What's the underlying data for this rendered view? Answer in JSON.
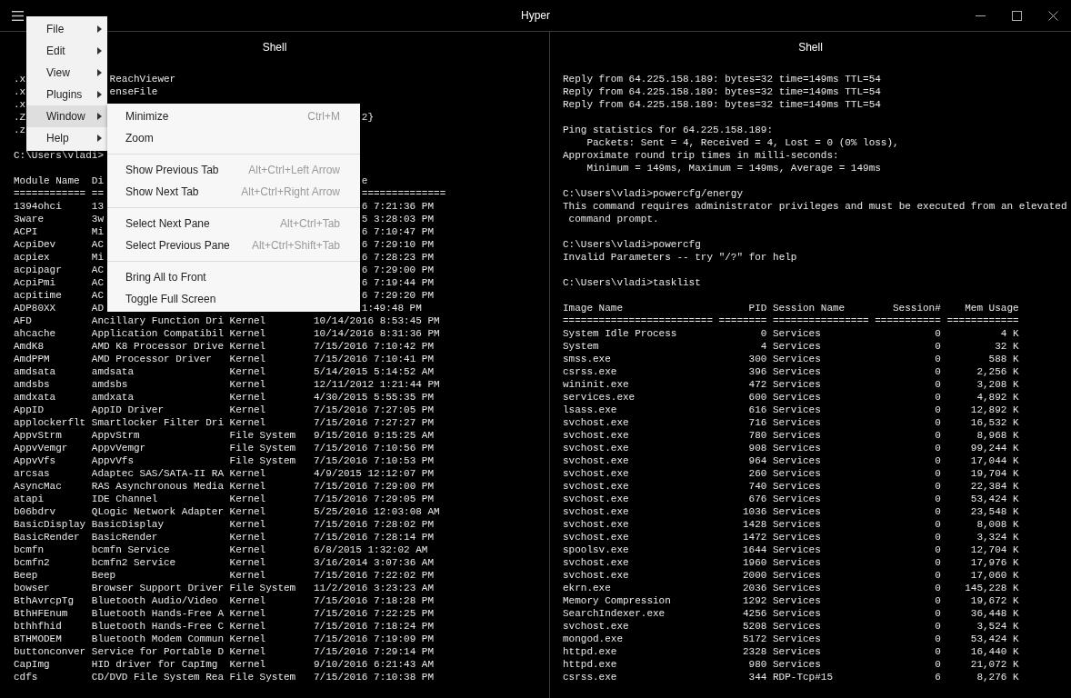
{
  "window": {
    "title": "Hyper"
  },
  "menu": {
    "items": [
      {
        "label": "File",
        "selected": false
      },
      {
        "label": "Edit",
        "selected": false
      },
      {
        "label": "View",
        "selected": false
      },
      {
        "label": "Plugins",
        "selected": false
      },
      {
        "label": "Window",
        "selected": true,
        "groups": [
          {
            "items": [
              {
                "label": "Minimize",
                "shortcut": "Ctrl+M"
              },
              {
                "label": "Zoom"
              }
            ]
          },
          {
            "items": [
              {
                "label": "Show Previous Tab",
                "shortcut": "Alt+Ctrl+Left Arrow"
              },
              {
                "label": "Show Next Tab",
                "shortcut": "Alt+Ctrl+Right Arrow"
              }
            ]
          },
          {
            "items": [
              {
                "label": "Select Next Pane",
                "shortcut": "Alt+Ctrl+Tab"
              },
              {
                "label": "Select Previous Pane",
                "shortcut": "Alt+Ctrl+Shift+Tab"
              }
            ]
          },
          {
            "items": [
              {
                "label": "Bring All to Front"
              },
              {
                "label": "Toggle Full Screen"
              }
            ]
          }
        ]
      },
      {
        "label": "Help",
        "selected": false
      }
    ]
  },
  "panes": [
    {
      "title": "Shell",
      "lines": [
        {
          "kind": "clipped",
          "head": ".x",
          "tail": "ReachViewer"
        },
        {
          "kind": "clipped",
          "head": ".x",
          "tail": "enseFile"
        },
        {
          "kind": "text",
          "text": ".x"
        },
        {
          "kind": "cut-row",
          "cells": [
            ".Z"
          ],
          "tail": "2}"
        },
        {
          "kind": "text",
          "text": ".z"
        },
        {
          "kind": "blank"
        },
        {
          "kind": "text",
          "text": "C:\\Users\\vladi>"
        },
        {
          "kind": "blank"
        },
        {
          "kind": "cut-row",
          "cells": [
            "Module Name",
            "Di"
          ],
          "tail": "e"
        },
        {
          "kind": "cut-row",
          "cells": [
            "============",
            "=="
          ],
          "tail": "=============="
        },
        {
          "kind": "cut-row",
          "cells": [
            "1394ohci",
            "13"
          ],
          "tail": "6 7:21:36 PM"
        },
        {
          "kind": "cut-row",
          "cells": [
            "3ware",
            "3w"
          ],
          "tail": "5 3:28:03 PM"
        },
        {
          "kind": "cut-row",
          "cells": [
            "ACPI",
            "Mi"
          ],
          "tail": "6 7:10:47 PM"
        },
        {
          "kind": "cut-row",
          "cells": [
            "AcpiDev",
            "AC"
          ],
          "tail": "6 7:29:10 PM"
        },
        {
          "kind": "cut-row",
          "cells": [
            "acpiex",
            "Mi"
          ],
          "tail": "6 7:28:23 PM"
        },
        {
          "kind": "cut-row",
          "cells": [
            "acpipagr",
            "AC"
          ],
          "tail": "6 7:29:00 PM"
        },
        {
          "kind": "cut-row",
          "cells": [
            "AcpiPmi",
            "AC"
          ],
          "tail": "6 7:19:44 PM"
        },
        {
          "kind": "cut-row",
          "cells": [
            "acpitime",
            "AC"
          ],
          "tail": "6 7:29:20 PM"
        },
        {
          "kind": "cut-row",
          "cells": [
            "ADP80XX",
            "AD"
          ],
          "tail": "1:49:48 PM"
        },
        {
          "kind": "module-row",
          "cells": [
            "AFD",
            "Ancillary Function Dri",
            "Kernel",
            "10/14/2016 8:53:45 PM"
          ]
        },
        {
          "kind": "module-row",
          "cells": [
            "ahcache",
            "Application Compatibil",
            "Kernel",
            "10/14/2016 8:31:36 PM"
          ]
        },
        {
          "kind": "module-row",
          "cells": [
            "AmdK8",
            "AMD K8 Processor Drive",
            "Kernel",
            "7/15/2016 7:10:42 PM"
          ]
        },
        {
          "kind": "module-row",
          "cells": [
            "AmdPPM",
            "AMD Processor Driver",
            "Kernel",
            "7/15/2016 7:10:41 PM"
          ]
        },
        {
          "kind": "module-row",
          "cells": [
            "amdsata",
            "amdsata",
            "Kernel",
            "5/14/2015 5:14:52 AM"
          ]
        },
        {
          "kind": "module-row",
          "cells": [
            "amdsbs",
            "amdsbs",
            "Kernel",
            "12/11/2012 1:21:44 PM"
          ]
        },
        {
          "kind": "module-row",
          "cells": [
            "amdxata",
            "amdxata",
            "Kernel",
            "4/30/2015 5:55:35 PM"
          ]
        },
        {
          "kind": "module-row",
          "cells": [
            "AppID",
            "AppID Driver",
            "Kernel",
            "7/15/2016 7:27:05 PM"
          ]
        },
        {
          "kind": "module-row",
          "cells": [
            "applockerflt",
            "Smartlocker Filter Dri",
            "Kernel",
            "7/15/2016 7:27:27 PM"
          ]
        },
        {
          "kind": "module-row",
          "cells": [
            "AppvStrm",
            "AppvStrm",
            "File System",
            "9/15/2016 9:15:25 AM"
          ]
        },
        {
          "kind": "module-row",
          "cells": [
            "AppvVemgr",
            "AppvVemgr",
            "File System",
            "7/15/2016 7:10:56 PM"
          ]
        },
        {
          "kind": "module-row",
          "cells": [
            "AppvVfs",
            "AppvVfs",
            "File System",
            "7/15/2016 7:10:53 PM"
          ]
        },
        {
          "kind": "module-row",
          "cells": [
            "arcsas",
            "Adaptec SAS/SATA-II RA",
            "Kernel",
            "4/9/2015 12:12:07 PM"
          ]
        },
        {
          "kind": "module-row",
          "cells": [
            "AsyncMac",
            "RAS Asynchronous Media",
            "Kernel",
            "7/15/2016 7:29:00 PM"
          ]
        },
        {
          "kind": "module-row",
          "cells": [
            "atapi",
            "IDE Channel",
            "Kernel",
            "7/15/2016 7:29:05 PM"
          ]
        },
        {
          "kind": "module-row",
          "cells": [
            "b06bdrv",
            "QLogic Network Adapter",
            "Kernel",
            "5/25/2016 12:03:08 AM"
          ]
        },
        {
          "kind": "module-row",
          "cells": [
            "BasicDisplay",
            "BasicDisplay",
            "Kernel",
            "7/15/2016 7:28:02 PM"
          ]
        },
        {
          "kind": "module-row",
          "cells": [
            "BasicRender",
            "BasicRender",
            "Kernel",
            "7/15/2016 7:28:14 PM"
          ]
        },
        {
          "kind": "module-row",
          "cells": [
            "bcmfn",
            "bcmfn Service",
            "Kernel",
            "6/8/2015 1:32:02 AM"
          ]
        },
        {
          "kind": "module-row",
          "cells": [
            "bcmfn2",
            "bcmfn2 Service",
            "Kernel",
            "3/16/2014 3:07:36 AM"
          ]
        },
        {
          "kind": "module-row",
          "cells": [
            "Beep",
            "Beep",
            "Kernel",
            "7/15/2016 7:22:02 PM"
          ]
        },
        {
          "kind": "module-row",
          "cells": [
            "bowser",
            "Browser Support Driver",
            "File System",
            "11/2/2016 3:23:23 AM"
          ]
        },
        {
          "kind": "module-row",
          "cells": [
            "BthAvrcpTg",
            "Bluetooth Audio/Video",
            "Kernel",
            "7/15/2016 7:18:28 PM"
          ]
        },
        {
          "kind": "module-row",
          "cells": [
            "BthHFEnum",
            "Bluetooth Hands-Free A",
            "Kernel",
            "7/15/2016 7:22:25 PM"
          ]
        },
        {
          "kind": "module-row",
          "cells": [
            "bthhfhid",
            "Bluetooth Hands-Free C",
            "Kernel",
            "7/15/2016 7:18:24 PM"
          ]
        },
        {
          "kind": "module-row",
          "cells": [
            "BTHMODEM",
            "Bluetooth Modem Commun",
            "Kernel",
            "7/15/2016 7:19:09 PM"
          ]
        },
        {
          "kind": "module-row",
          "cells": [
            "buttonconver",
            "Service for Portable D",
            "Kernel",
            "7/15/2016 7:29:14 PM"
          ]
        },
        {
          "kind": "module-row",
          "cells": [
            "CapImg",
            "HID driver for CapImg",
            "Kernel",
            "9/10/2016 6:21:43 AM"
          ]
        },
        {
          "kind": "module-row",
          "cells": [
            "cdfs",
            "CD/DVD File System Rea",
            "File System",
            "7/15/2016 7:10:38 PM"
          ]
        }
      ]
    },
    {
      "title": "Shell",
      "lines": [
        {
          "kind": "text",
          "text": "Reply from 64.225.158.189: bytes=32 time=149ms TTL=54"
        },
        {
          "kind": "text",
          "text": "Reply from 64.225.158.189: bytes=32 time=149ms TTL=54"
        },
        {
          "kind": "text",
          "text": "Reply from 64.225.158.189: bytes=32 time=149ms TTL=54"
        },
        {
          "kind": "blank"
        },
        {
          "kind": "text",
          "text": "Ping statistics for 64.225.158.189:"
        },
        {
          "kind": "text",
          "text": "    Packets: Sent = 4, Received = 4, Lost = 0 (0% loss),"
        },
        {
          "kind": "text",
          "text": "Approximate round trip times in milli-seconds:"
        },
        {
          "kind": "text",
          "text": "    Minimum = 149ms, Maximum = 149ms, Average = 149ms"
        },
        {
          "kind": "blank"
        },
        {
          "kind": "text",
          "text": "C:\\Users\\vladi>powercfg/energy"
        },
        {
          "kind": "text",
          "text": "This command requires administrator privileges and must be executed from an elevated"
        },
        {
          "kind": "text",
          "text": " command prompt."
        },
        {
          "kind": "blank"
        },
        {
          "kind": "text",
          "text": "C:\\Users\\vladi>powercfg"
        },
        {
          "kind": "text",
          "text": "Invalid Parameters -- try \"/?\" for help"
        },
        {
          "kind": "blank"
        },
        {
          "kind": "text",
          "text": "C:\\Users\\vladi>tasklist"
        },
        {
          "kind": "blank"
        },
        {
          "kind": "task-row",
          "cells": [
            "Image Name",
            "PID",
            "Session Name",
            "Session#",
            "Mem Usage"
          ]
        },
        {
          "kind": "task-row",
          "cells": [
            "=========================",
            "========",
            "================",
            "===========",
            "============"
          ]
        },
        {
          "kind": "task-row",
          "cells": [
            "System Idle Process",
            "0",
            "Services",
            "0",
            "4 K"
          ]
        },
        {
          "kind": "task-row",
          "cells": [
            "System",
            "4",
            "Services",
            "0",
            "32 K"
          ]
        },
        {
          "kind": "task-row",
          "cells": [
            "smss.exe",
            "300",
            "Services",
            "0",
            "588 K"
          ]
        },
        {
          "kind": "task-row",
          "cells": [
            "csrss.exe",
            "396",
            "Services",
            "0",
            "2,256 K"
          ]
        },
        {
          "kind": "task-row",
          "cells": [
            "wininit.exe",
            "472",
            "Services",
            "0",
            "3,208 K"
          ]
        },
        {
          "kind": "task-row",
          "cells": [
            "services.exe",
            "600",
            "Services",
            "0",
            "4,892 K"
          ]
        },
        {
          "kind": "task-row",
          "cells": [
            "lsass.exe",
            "616",
            "Services",
            "0",
            "12,892 K"
          ]
        },
        {
          "kind": "task-row",
          "cells": [
            "svchost.exe",
            "716",
            "Services",
            "0",
            "16,532 K"
          ]
        },
        {
          "kind": "task-row",
          "cells": [
            "svchost.exe",
            "780",
            "Services",
            "0",
            "8,968 K"
          ]
        },
        {
          "kind": "task-row",
          "cells": [
            "svchost.exe",
            "908",
            "Services",
            "0",
            "99,244 K"
          ]
        },
        {
          "kind": "task-row",
          "cells": [
            "svchost.exe",
            "964",
            "Services",
            "0",
            "17,044 K"
          ]
        },
        {
          "kind": "task-row",
          "cells": [
            "svchost.exe",
            "260",
            "Services",
            "0",
            "19,704 K"
          ]
        },
        {
          "kind": "task-row",
          "cells": [
            "svchost.exe",
            "740",
            "Services",
            "0",
            "22,384 K"
          ]
        },
        {
          "kind": "task-row",
          "cells": [
            "svchost.exe",
            "676",
            "Services",
            "0",
            "53,424 K"
          ]
        },
        {
          "kind": "task-row",
          "cells": [
            "svchost.exe",
            "1036",
            "Services",
            "0",
            "23,548 K"
          ]
        },
        {
          "kind": "task-row",
          "cells": [
            "svchost.exe",
            "1428",
            "Services",
            "0",
            "8,008 K"
          ]
        },
        {
          "kind": "task-row",
          "cells": [
            "svchost.exe",
            "1472",
            "Services",
            "0",
            "3,324 K"
          ]
        },
        {
          "kind": "task-row",
          "cells": [
            "spoolsv.exe",
            "1644",
            "Services",
            "0",
            "12,704 K"
          ]
        },
        {
          "kind": "task-row",
          "cells": [
            "svchost.exe",
            "1960",
            "Services",
            "0",
            "17,976 K"
          ]
        },
        {
          "kind": "task-row",
          "cells": [
            "svchost.exe",
            "2000",
            "Services",
            "0",
            "17,060 K"
          ]
        },
        {
          "kind": "task-row",
          "cells": [
            "ekrn.exe",
            "2036",
            "Services",
            "0",
            "145,228 K"
          ]
        },
        {
          "kind": "task-row",
          "cells": [
            "Memory Compression",
            "1292",
            "Services",
            "0",
            "19,672 K"
          ]
        },
        {
          "kind": "task-row",
          "cells": [
            "SearchIndexer.exe",
            "4256",
            "Services",
            "0",
            "36,448 K"
          ]
        },
        {
          "kind": "task-row",
          "cells": [
            "svchost.exe",
            "5208",
            "Services",
            "0",
            "3,524 K"
          ]
        },
        {
          "kind": "task-row",
          "cells": [
            "mongod.exe",
            "5172",
            "Services",
            "0",
            "53,424 K"
          ]
        },
        {
          "kind": "task-row",
          "cells": [
            "httpd.exe",
            "2328",
            "Services",
            "0",
            "16,440 K"
          ]
        },
        {
          "kind": "task-row",
          "cells": [
            "httpd.exe",
            "980",
            "Services",
            "0",
            "21,072 K"
          ]
        },
        {
          "kind": "task-row",
          "cells": [
            "csrss.exe",
            "344",
            "RDP-Tcp#15",
            "6",
            "8,276 K"
          ]
        }
      ]
    }
  ]
}
